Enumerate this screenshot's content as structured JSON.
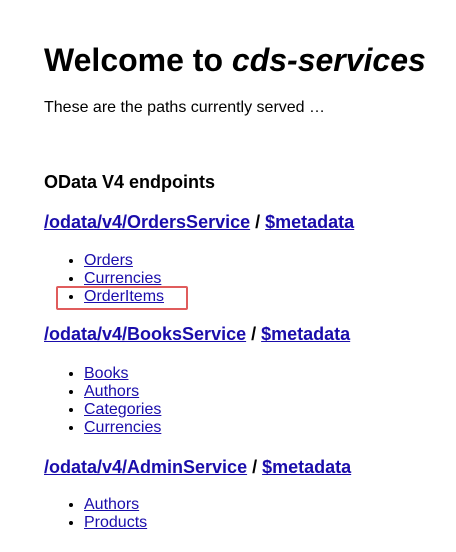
{
  "header": {
    "title_prefix": "Welcome to ",
    "title_app": "cds-services",
    "intro": "These are the paths currently served …"
  },
  "section": {
    "title": "OData V4 endpoints"
  },
  "services": [
    {
      "path": "/odata/v4/OrdersService",
      "separator": " / ",
      "metadata_label": "$metadata",
      "entities": [
        "Orders",
        "Currencies",
        "OrderItems"
      ]
    },
    {
      "path": "/odata/v4/BooksService",
      "separator": " / ",
      "metadata_label": "$metadata",
      "entities": [
        "Books",
        "Authors",
        "Categories",
        "Currencies"
      ]
    },
    {
      "path": "/odata/v4/AdminService",
      "separator": " / ",
      "metadata_label": "$metadata",
      "entities": [
        "Authors",
        "Products"
      ]
    }
  ],
  "colors": {
    "link": "#1a0dab",
    "highlight": "#e05c5c"
  },
  "highlighted_entity": "OrderItems"
}
